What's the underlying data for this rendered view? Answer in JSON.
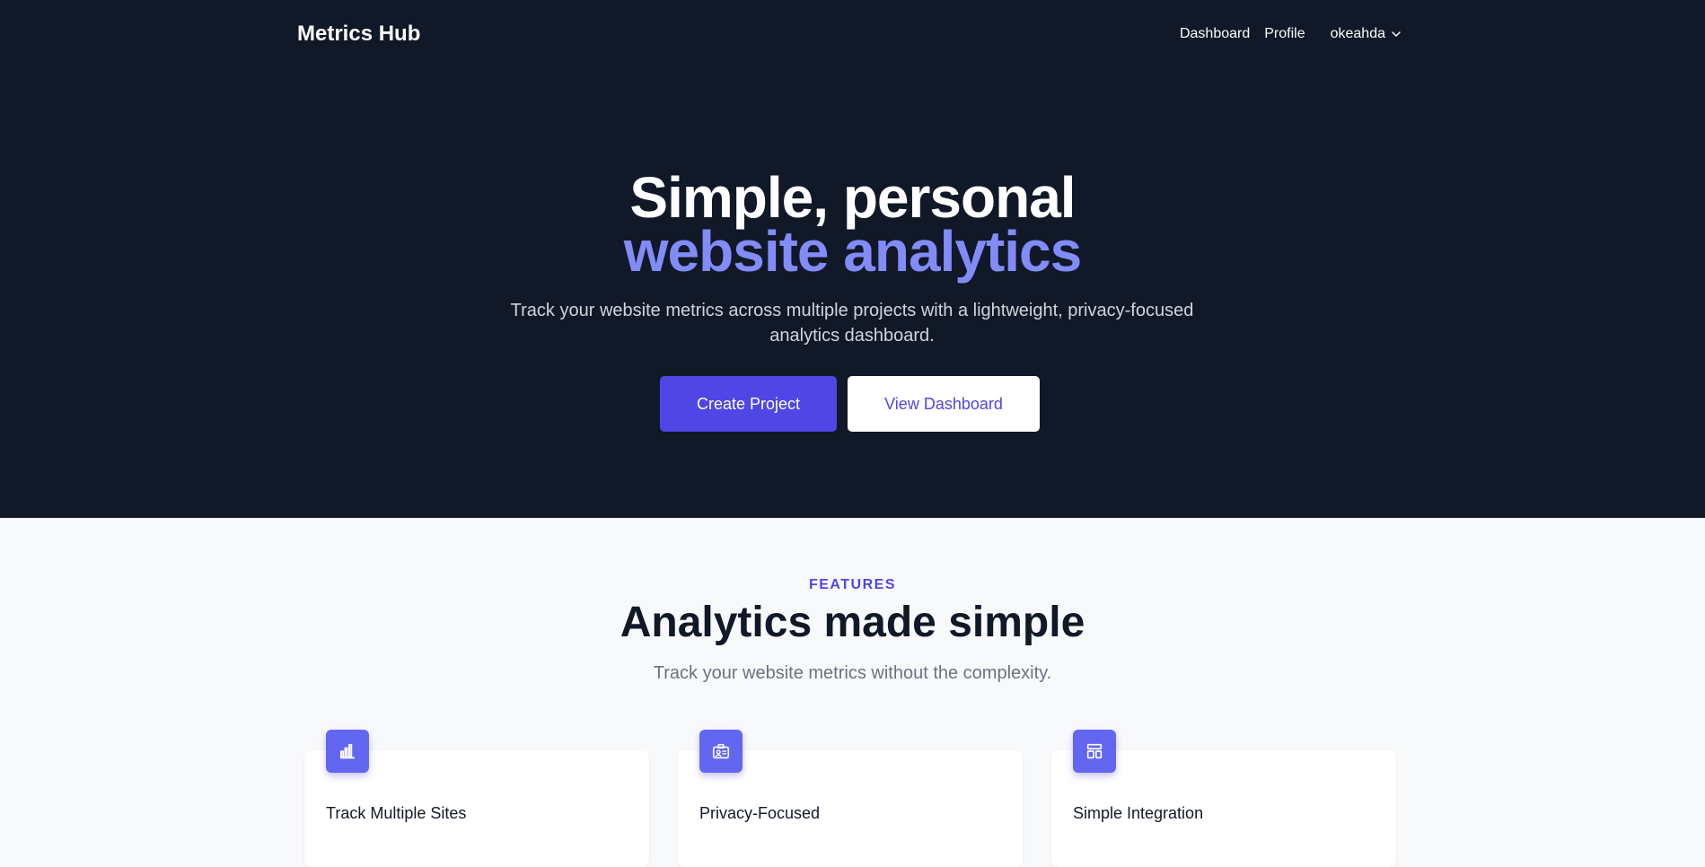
{
  "header": {
    "brand": "Metrics Hub",
    "nav": [
      {
        "label": "Dashboard"
      },
      {
        "label": "Profile"
      }
    ],
    "user": {
      "name": "okeahda",
      "icon": "chevron-down-icon"
    }
  },
  "hero": {
    "title_line1": "Simple, personal",
    "title_line2": "website analytics",
    "subtitle": "Track your website metrics across multiple projects with a lightweight, privacy-focused analytics dashboard.",
    "primary_button": "Create Project",
    "secondary_button": "View Dashboard"
  },
  "features": {
    "eyebrow": "FEATURES",
    "title": "Analytics made simple",
    "subtitle": "Track your website metrics without the complexity.",
    "cards": [
      {
        "title": "Track Multiple Sites",
        "icon": "bar-chart-icon"
      },
      {
        "title": "Privacy-Focused",
        "icon": "id-card-icon"
      },
      {
        "title": "Simple Integration",
        "icon": "layout-icon"
      }
    ]
  },
  "colors": {
    "hero_bg": "#111827",
    "accent": "#4f46e5",
    "accent_light": "#818cf8",
    "icon_bg": "#6366f1",
    "page_bg": "#f8f9fb"
  }
}
